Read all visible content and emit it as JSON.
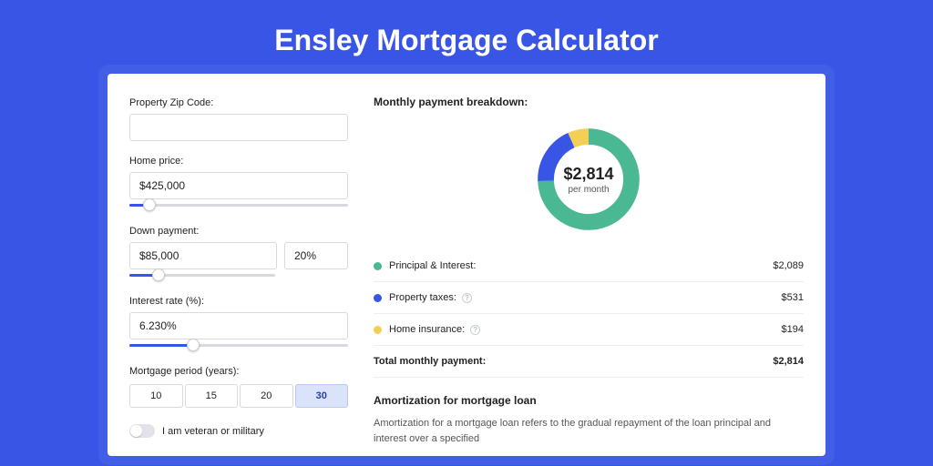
{
  "title": "Ensley Mortgage Calculator",
  "colors": {
    "principal": "#4bb894",
    "taxes": "#3855e5",
    "insurance": "#f3cf55"
  },
  "form": {
    "zip": {
      "label": "Property Zip Code:",
      "value": ""
    },
    "homePrice": {
      "label": "Home price:",
      "value": "$425,000",
      "sliderPct": 9
    },
    "downPayment": {
      "label": "Down payment:",
      "amount": "$85,000",
      "percent": "20%",
      "sliderPct": 20
    },
    "interestRate": {
      "label": "Interest rate (%):",
      "value": "6.230%",
      "sliderPct": 29
    },
    "period": {
      "label": "Mortgage period (years):",
      "options": [
        "10",
        "15",
        "20",
        "30"
      ],
      "active": "30"
    },
    "veteranToggle": {
      "label": "I am veteran or military",
      "on": false
    }
  },
  "breakdown": {
    "title": "Monthly payment breakdown:",
    "centerAmount": "$2,814",
    "centerLabel": "per month",
    "items": [
      {
        "name": "Principal & Interest:",
        "value": "$2,089",
        "colorKey": "principal",
        "info": false
      },
      {
        "name": "Property taxes:",
        "value": "$531",
        "colorKey": "taxes",
        "info": true
      },
      {
        "name": "Home insurance:",
        "value": "$194",
        "colorKey": "insurance",
        "info": true
      }
    ],
    "total": {
      "name": "Total monthly payment:",
      "value": "$2,814"
    }
  },
  "amortization": {
    "title": "Amortization for mortgage loan",
    "text": "Amortization for a mortgage loan refers to the gradual repayment of the loan principal and interest over a specified"
  },
  "chart_data": {
    "type": "pie",
    "title": "Monthly payment breakdown",
    "series": [
      {
        "name": "Principal & Interest",
        "value": 2089,
        "color": "#4bb894"
      },
      {
        "name": "Property taxes",
        "value": 531,
        "color": "#3855e5"
      },
      {
        "name": "Home insurance",
        "value": 194,
        "color": "#f3cf55"
      }
    ],
    "total": 2814,
    "center_label": "$2,814 per month"
  }
}
